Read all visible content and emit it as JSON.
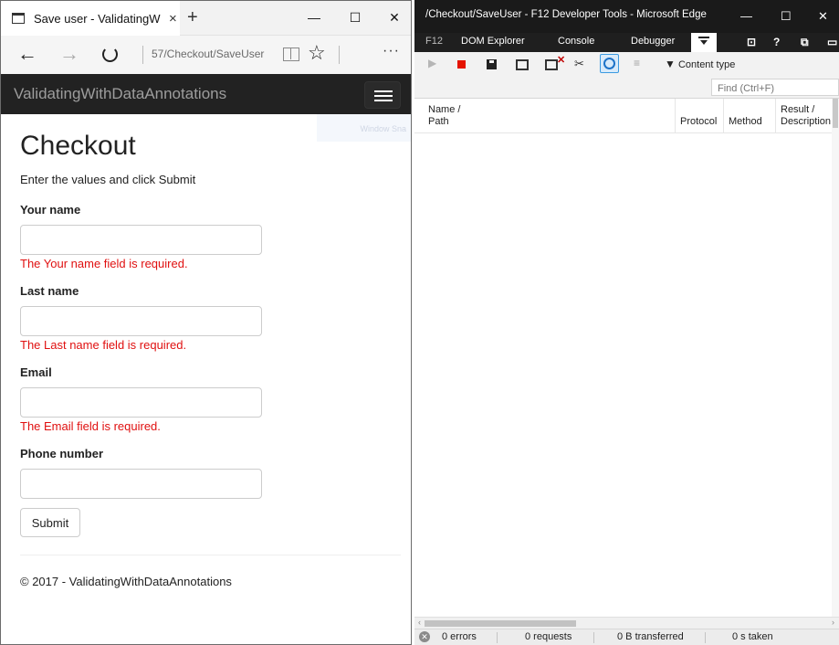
{
  "browser": {
    "tab_title": "Save user - ValidatingW",
    "tab_close": "×",
    "new_tab": "+",
    "win_minimize": "—",
    "win_maximize": "☐",
    "win_close": "✕",
    "back": "←",
    "forward": "→",
    "address": "57/Checkout/SaveUser",
    "favorite": "☆",
    "more": "···"
  },
  "site": {
    "brand": "ValidatingWithDataAnnotations",
    "ghost_tooltip": "Window Sna"
  },
  "form": {
    "title": "Checkout",
    "intro": "Enter the values and click Submit",
    "fields": [
      {
        "label": "Your name",
        "value": "",
        "error": "The Your name field is required."
      },
      {
        "label": "Last name",
        "value": "",
        "error": "The Last name field is required."
      },
      {
        "label": "Email",
        "value": "",
        "error": "The Email field is required."
      },
      {
        "label": "Phone number",
        "value": "",
        "error": ""
      }
    ],
    "submit_label": "Submit",
    "footer": "© 2017 - ValidatingWithDataAnnotations"
  },
  "devtools": {
    "title": "/Checkout/SaveUser - F12 Developer Tools - Microsoft Edge",
    "win_minimize": "—",
    "win_maximize": "☐",
    "win_close": "✕",
    "tabs": {
      "f12": "F12",
      "dom": "DOM Explorer",
      "console": "Console",
      "debugger": "Debugger"
    },
    "tab_icons": {
      "emulation": "⊡",
      "help": "?",
      "dock": "⧉"
    },
    "toolbar": {
      "play": "▶",
      "filter_label": "Content type"
    },
    "find_placeholder": "Find (Ctrl+F)",
    "columns": {
      "name": "Name /",
      "path": "Path",
      "protocol": "Protocol",
      "method": "Method",
      "result": "Result /",
      "description": "Description"
    },
    "status": {
      "errors": "0 errors",
      "requests": "0 requests",
      "transferred": "0 B transferred",
      "taken": "0 s taken"
    }
  },
  "colors": {
    "navbar": "#222222",
    "error": "#e01010",
    "devtools_titlebar": "#1a1a1a",
    "record_stop": "#e51400",
    "active_tool": "#1e73c8"
  }
}
